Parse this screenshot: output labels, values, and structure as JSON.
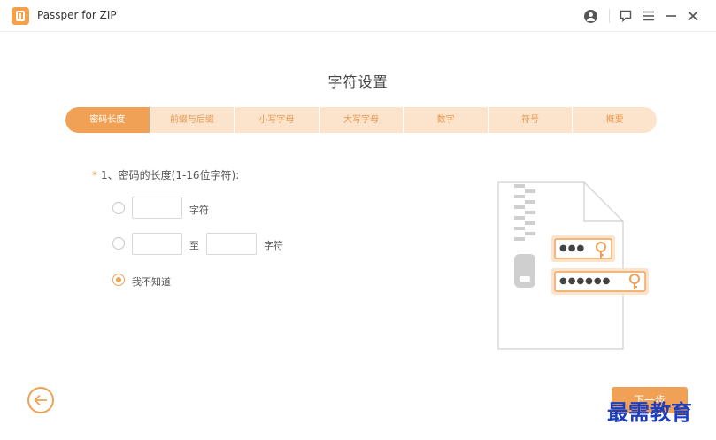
{
  "app": {
    "title": "Passper for ZIP",
    "logo_icon": "passper-zip-logo-icon"
  },
  "window_controls": [
    "user-account-icon",
    "feedback-icon",
    "menu-icon",
    "minimize-icon",
    "close-icon"
  ],
  "section_title": "字符设置",
  "steps": [
    {
      "label": "密码长度",
      "active": true
    },
    {
      "label": "前缀与后缀",
      "active": false
    },
    {
      "label": "小写字母",
      "active": false
    },
    {
      "label": "大写字母",
      "active": false
    },
    {
      "label": "数字",
      "active": false
    },
    {
      "label": "符号",
      "active": false
    },
    {
      "label": "概要",
      "active": false
    }
  ],
  "question": {
    "required_mark": "*",
    "label": "1、密码的长度(1-16位字符):"
  },
  "options": {
    "exact": {
      "unit": "字符",
      "value": "",
      "selected": false
    },
    "range": {
      "connector": "至",
      "unit": "字符",
      "from": "",
      "to": "",
      "selected": false
    },
    "unknown": {
      "label": "我不知道",
      "selected": true
    }
  },
  "illustration": {
    "short_password_mask": "●●●",
    "long_password_mask": "●●●●●●",
    "icon": "zip-file-with-keys-icon"
  },
  "footer": {
    "back_icon": "arrow-left-icon",
    "next_label": "下一步"
  },
  "watermark": "最需教育",
  "colors": {
    "accent": "#f0a155",
    "accent_light": "#fbe3cc",
    "watermark": "#1d3fbf"
  }
}
